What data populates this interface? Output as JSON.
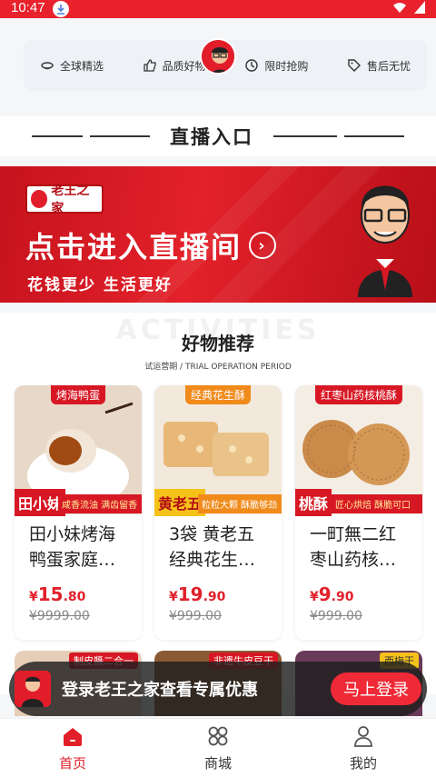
{
  "status_bar": {
    "time": "10:47"
  },
  "features": {
    "items": [
      {
        "label": "全球精选",
        "icon": "globe-icon"
      },
      {
        "label": "品质好物",
        "icon": "thumbs-up-icon"
      },
      {
        "label": "限时抢购",
        "icon": "clock-icon"
      },
      {
        "label": "售后无忧",
        "icon": "tag-icon"
      }
    ]
  },
  "live_section": {
    "title": "直播入口"
  },
  "banner": {
    "brand": "老王之家",
    "headline": "点击进入直播间",
    "slogan": "花钱更少  生活更好",
    "accent": "#e3212a"
  },
  "recommend": {
    "watermark": "ACTIVITIES",
    "title": "好物推荐",
    "subtitle": "试运营期 / TRIAL OPERATION PERIOD"
  },
  "products": [
    {
      "top_tag": "烤海鸭蛋",
      "brand_tag": "田小妹",
      "strip": "咸香流油 满齿留香",
      "name": "田小妹烤海鸭蛋家庭…",
      "price_int": "15",
      "price_dec": ".80",
      "currency": "¥",
      "original_price": "¥9999.00"
    },
    {
      "top_tag": "经典花生酥",
      "brand_tag": "黄老五",
      "strip": "粒粒大颗 酥脆够劲",
      "name": "3袋 黄老五经典花生…",
      "price_int": "19",
      "price_dec": ".90",
      "currency": "¥",
      "original_price": "¥999.00"
    },
    {
      "top_tag": "红枣山药核桃酥",
      "brand_tag": "桃酥",
      "strip": "匠心烘焙 酥脆可口",
      "name": "一町無二红枣山药核…",
      "price_int": "9",
      "price_dec": ".90",
      "currency": "¥",
      "original_price": "¥999.00"
    }
  ],
  "peek_items": [
    {
      "label": "制皮醬二合一"
    },
    {
      "label": "非遗牛皮豆干"
    },
    {
      "label": "西梅干"
    }
  ],
  "login_prompt": {
    "message": "登录老王之家查看专属优惠",
    "button": "马上登录"
  },
  "tabbar": {
    "tabs": [
      {
        "label": "首页",
        "icon": "home-icon",
        "active": true
      },
      {
        "label": "商城",
        "icon": "grid-icon",
        "active": false
      },
      {
        "label": "我的",
        "icon": "user-icon",
        "active": false
      }
    ]
  }
}
